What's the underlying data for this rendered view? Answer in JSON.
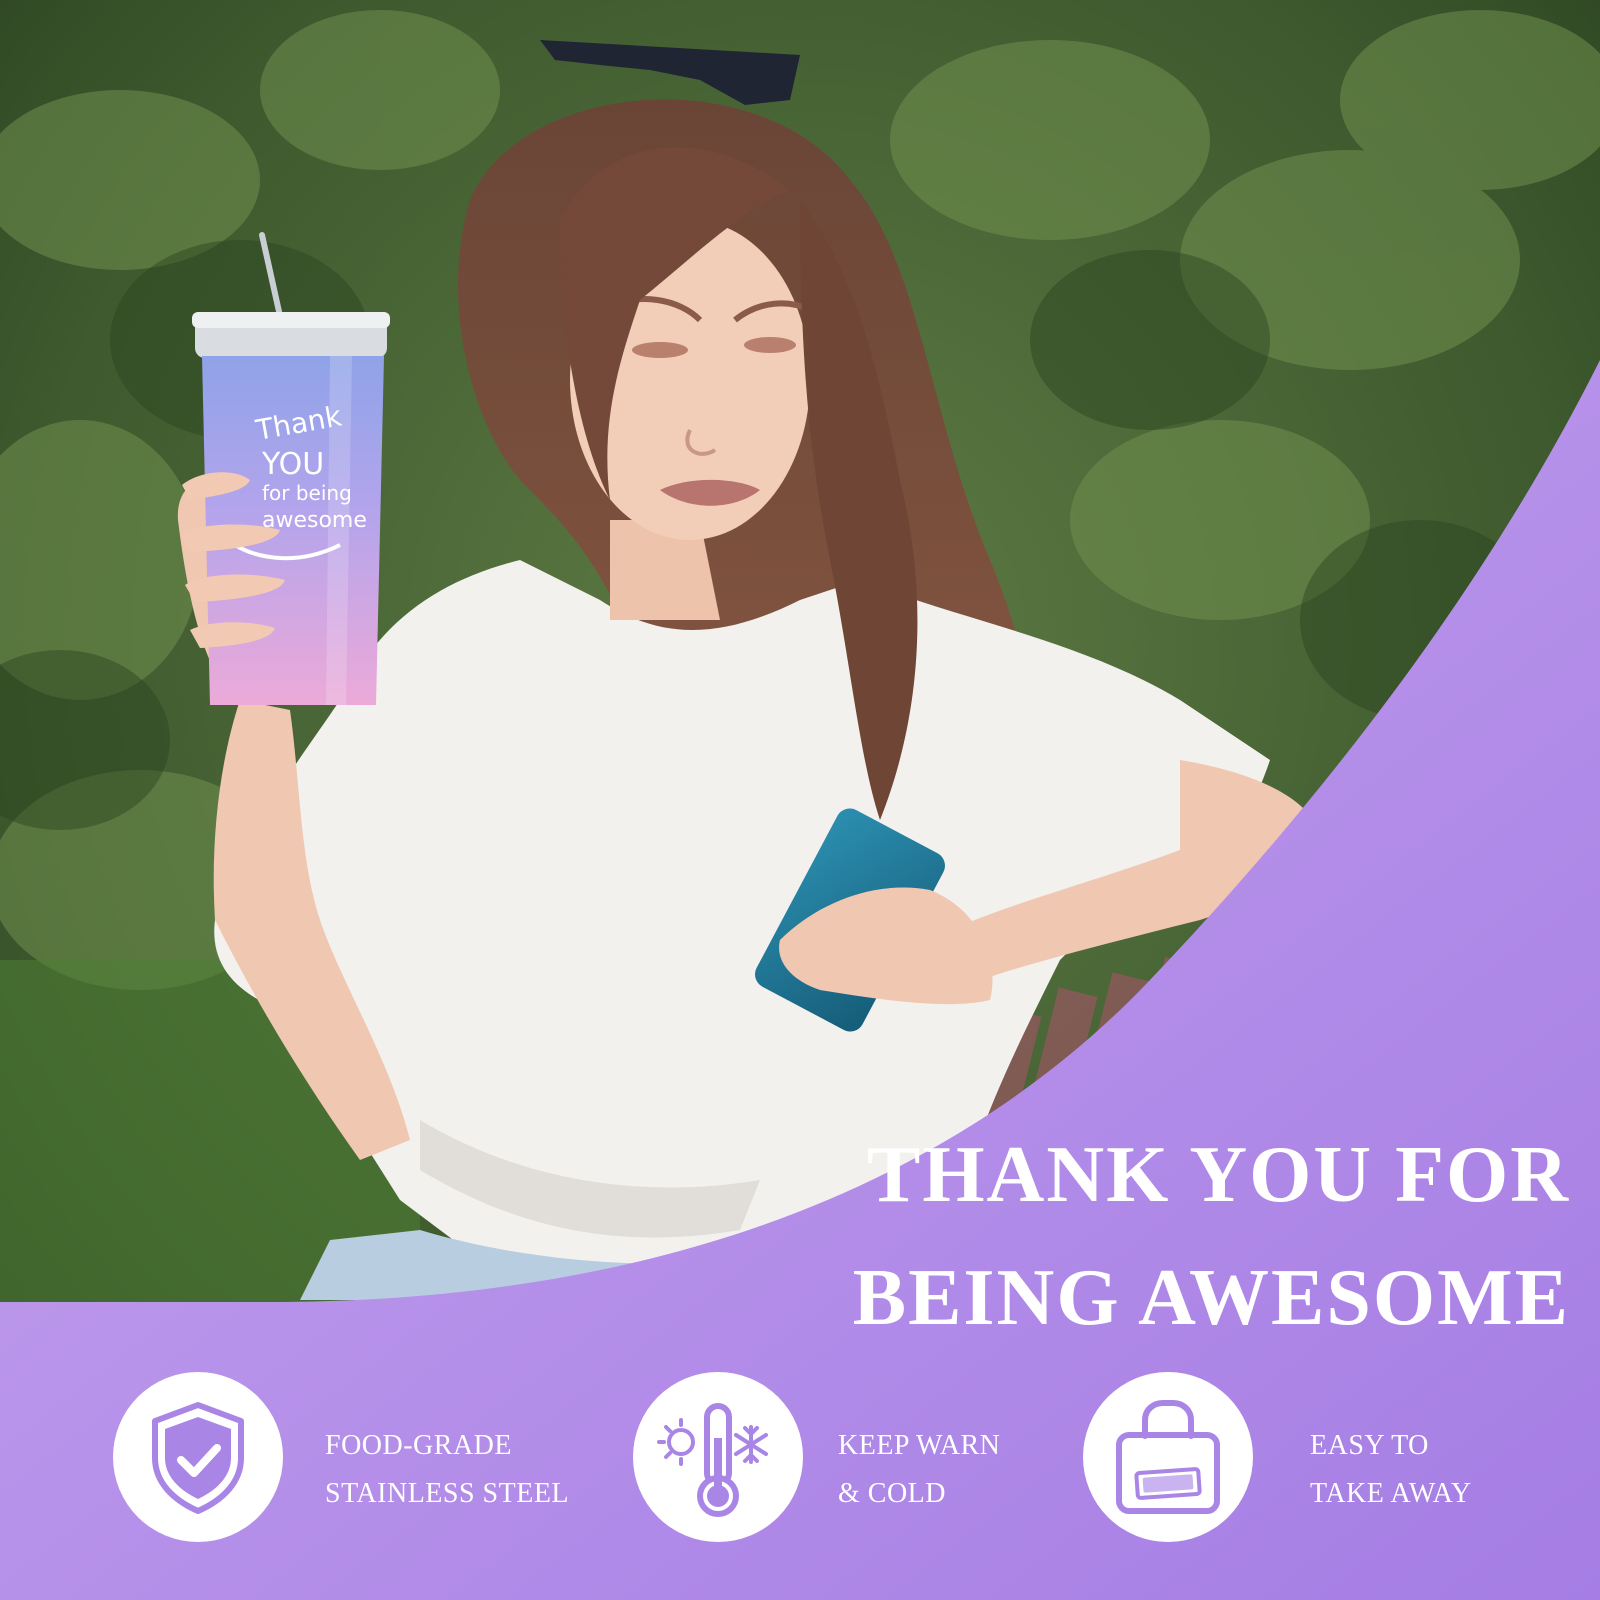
{
  "headline": {
    "line1": "THANK YOU FOR",
    "line2": "BEING AWESOME"
  },
  "tumbler_print": {
    "line1": "Thank",
    "line2": "YOU",
    "line3": "for being",
    "line4": "awesome"
  },
  "features": [
    {
      "icon": "shield-check-icon",
      "line1": "FOOD-GRADE",
      "line2": "STAINLESS STEEL"
    },
    {
      "icon": "thermometer-sun-snowflake-icon",
      "line1": "KEEP WARN",
      "line2": "& COLD"
    },
    {
      "icon": "bag-icon",
      "line1": "EASY TO",
      "line2": "TAKE AWAY"
    }
  ],
  "colors": {
    "panel_light": "#c3a0ec",
    "panel_dark": "#a982e6",
    "icon_purple": "#a985e6",
    "tumbler_blue": "#8fa3e8",
    "tumbler_pink": "#e9a6d8",
    "foliage": "#3d5a2e"
  }
}
